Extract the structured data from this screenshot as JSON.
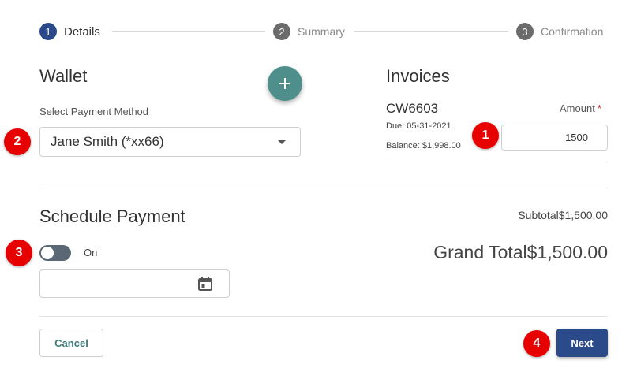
{
  "stepper": {
    "steps": [
      {
        "number": "1",
        "label": "Details",
        "state": "active"
      },
      {
        "number": "2",
        "label": "Summary",
        "state": "inactive"
      },
      {
        "number": "3",
        "label": "Confirmation",
        "state": "inactive"
      }
    ]
  },
  "wallet": {
    "title": "Wallet",
    "add_icon": "plus-icon",
    "payment_method_label": "Select Payment Method",
    "payment_method_value": "Jane Smith (*xx66)"
  },
  "invoices": {
    "title": "Invoices",
    "amount_label": "Amount",
    "required_mark": "*",
    "items": [
      {
        "id": "CW6603",
        "due": "Due: 05-31-2021",
        "balance": "Balance: $1,998.00",
        "amount": "1500"
      }
    ]
  },
  "schedule": {
    "title": "Schedule Payment",
    "toggle_label": "On",
    "date_value": "",
    "calendar_icon": "calendar-icon"
  },
  "totals": {
    "subtotal": "Subtotal$1,500.00",
    "grand_total": "Grand Total$1,500.00"
  },
  "actions": {
    "cancel_label": "Cancel",
    "next_label": "Next"
  },
  "annotations": [
    "1",
    "2",
    "3",
    "4"
  ],
  "colors": {
    "primary": "#2a4a8a",
    "teal": "#4e8f8c",
    "badge": "#e60000"
  }
}
